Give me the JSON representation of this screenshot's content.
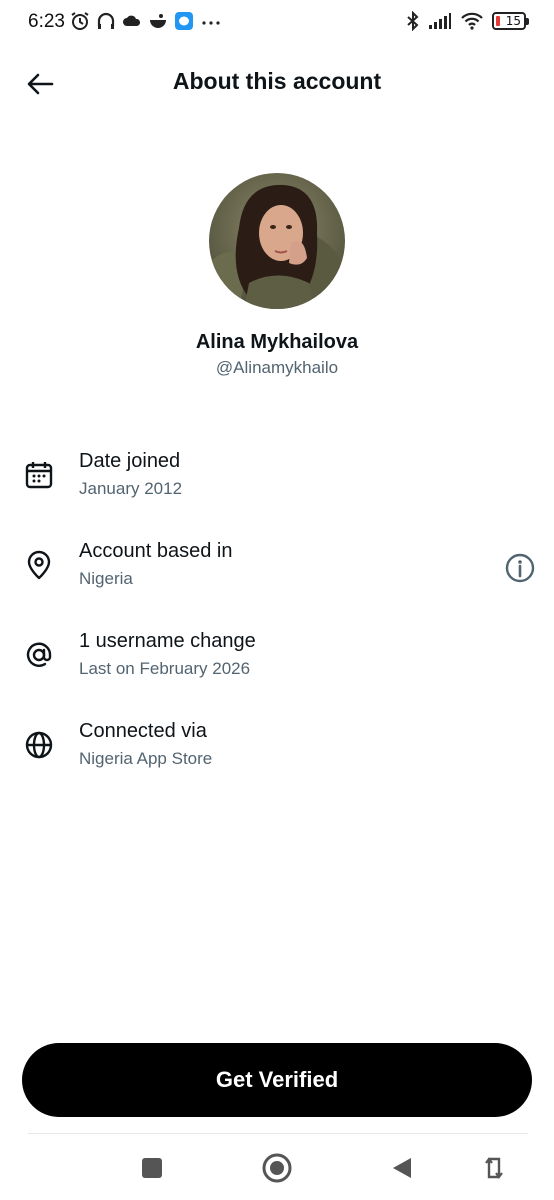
{
  "status_bar": {
    "time": "6:23",
    "battery_level": "15",
    "battery_color": "#e53935"
  },
  "header": {
    "title": "About this account",
    "back_icon": "arrow-left-icon"
  },
  "profile": {
    "name": "Alina Mykhailova",
    "handle": "@Alinamykhailo"
  },
  "info": [
    {
      "icon": "calendar-icon",
      "title": "Date joined",
      "subtitle": "January 2012"
    },
    {
      "icon": "location-pin-icon",
      "title": "Account based in",
      "subtitle": "Nigeria",
      "action_icon": "info-circle-icon"
    },
    {
      "icon": "at-sign-icon",
      "title": "1 username change",
      "subtitle": "Last on February 2026"
    },
    {
      "icon": "globe-icon",
      "title": "Connected via",
      "subtitle": "Nigeria App Store"
    }
  ],
  "cta": {
    "label": "Get Verified"
  },
  "colors": {
    "primary_text": "#0f1419",
    "secondary_text": "#536471",
    "cta_background": "#000000",
    "cta_text": "#ffffff"
  }
}
